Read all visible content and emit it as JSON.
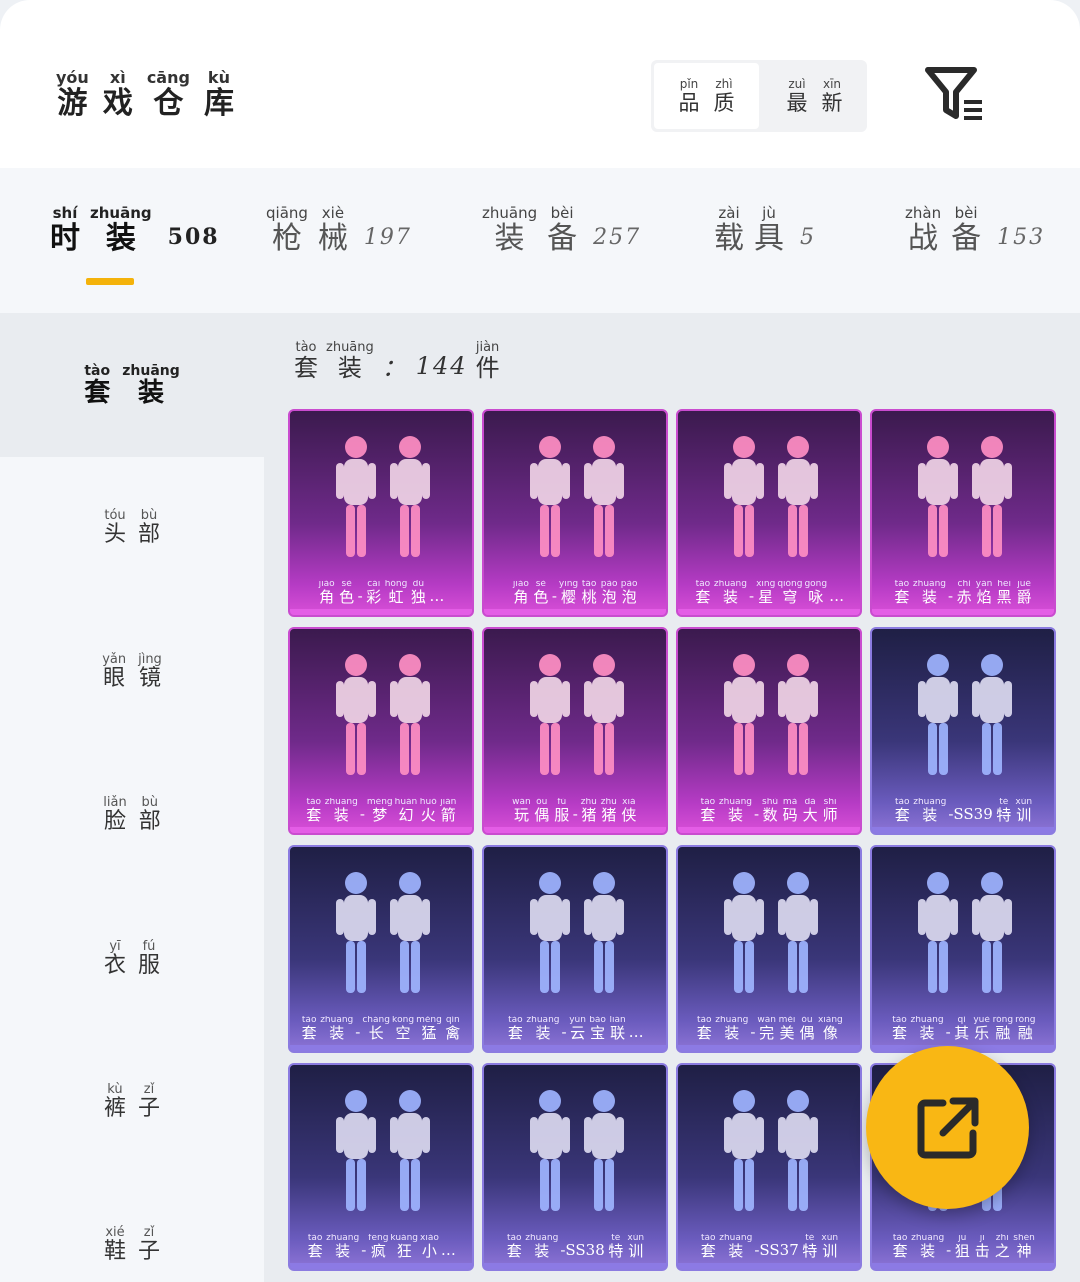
{
  "header": {
    "title": [
      {
        "py": "yóu",
        "hz": "游"
      },
      {
        "py": "xì",
        "hz": "戏"
      },
      {
        "py": "cāng",
        "hz": "仓"
      },
      {
        "py": "kù",
        "hz": "库"
      }
    ],
    "sort": [
      {
        "chars": [
          {
            "py": "pǐn",
            "hz": "品"
          },
          {
            "py": "zhì",
            "hz": "质"
          }
        ],
        "active": true
      },
      {
        "chars": [
          {
            "py": "zuì",
            "hz": "最"
          },
          {
            "py": "xīn",
            "hz": "新"
          }
        ],
        "active": false
      }
    ],
    "filter_icon": "filter-list-icon"
  },
  "tabs": [
    {
      "chars": [
        {
          "py": "shí",
          "hz": "时"
        },
        {
          "py": "zhuāng",
          "hz": "装"
        }
      ],
      "count": "508",
      "active": true
    },
    {
      "chars": [
        {
          "py": "qiāng",
          "hz": "枪"
        },
        {
          "py": "xiè",
          "hz": "械"
        }
      ],
      "count": "197",
      "active": false
    },
    {
      "chars": [
        {
          "py": "zhuāng",
          "hz": "装"
        },
        {
          "py": "bèi",
          "hz": "备"
        }
      ],
      "count": "257",
      "active": false
    },
    {
      "chars": [
        {
          "py": "zài",
          "hz": "载"
        },
        {
          "py": "jù",
          "hz": "具"
        }
      ],
      "count": "5",
      "active": false
    },
    {
      "chars": [
        {
          "py": "zhàn",
          "hz": "战"
        },
        {
          "py": "bèi",
          "hz": "备"
        }
      ],
      "count": "153",
      "active": false
    }
  ],
  "sidebar": [
    {
      "chars": [
        {
          "py": "tào",
          "hz": "套"
        },
        {
          "py": "zhuāng",
          "hz": "装"
        }
      ],
      "active": true
    },
    {
      "chars": [
        {
          "py": "tóu",
          "hz": "头"
        },
        {
          "py": "bù",
          "hz": "部"
        }
      ],
      "active": false
    },
    {
      "chars": [
        {
          "py": "yǎn",
          "hz": "眼"
        },
        {
          "py": "jìng",
          "hz": "镜"
        }
      ],
      "active": false
    },
    {
      "chars": [
        {
          "py": "liǎn",
          "hz": "脸"
        },
        {
          "py": "bù",
          "hz": "部"
        }
      ],
      "active": false
    },
    {
      "chars": [
        {
          "py": "yī",
          "hz": "衣"
        },
        {
          "py": "fú",
          "hz": "服"
        }
      ],
      "active": false
    },
    {
      "chars": [
        {
          "py": "kù",
          "hz": "裤"
        },
        {
          "py": "zǐ",
          "hz": "子"
        }
      ],
      "active": false
    },
    {
      "chars": [
        {
          "py": "xié",
          "hz": "鞋"
        },
        {
          "py": "zǐ",
          "hz": "子"
        }
      ],
      "active": false
    }
  ],
  "section": {
    "chars": [
      {
        "py": "tào",
        "hz": "套"
      },
      {
        "py": "zhuāng",
        "hz": "装"
      }
    ],
    "sep": "：",
    "count": "144",
    "unit": {
      "py": "jiàn",
      "hz": "件"
    }
  },
  "items": [
    {
      "theme": "pink",
      "figure": "pink",
      "tokens": [
        {
          "py": "jiǎo",
          "hz": "角"
        },
        {
          "py": "sè",
          "hz": "色"
        },
        {
          "t": "-"
        },
        {
          "py": "cǎi",
          "hz": "彩"
        },
        {
          "py": "hóng",
          "hz": "虹"
        },
        {
          "py": "dú",
          "hz": "独"
        },
        {
          "t": "…"
        }
      ]
    },
    {
      "theme": "pink",
      "figure": "pink",
      "tokens": [
        {
          "py": "jiǎo",
          "hz": "角"
        },
        {
          "py": "sè",
          "hz": "色"
        },
        {
          "t": "-"
        },
        {
          "py": "yīng",
          "hz": "樱"
        },
        {
          "py": "táo",
          "hz": "桃"
        },
        {
          "py": "pào",
          "hz": "泡"
        },
        {
          "py": "pào",
          "hz": "泡"
        }
      ]
    },
    {
      "theme": "pink",
      "figure": "pink",
      "tokens": [
        {
          "py": "tào",
          "hz": "套"
        },
        {
          "py": "zhuāng",
          "hz": "装"
        },
        {
          "t": "-"
        },
        {
          "py": "xīng",
          "hz": "星"
        },
        {
          "py": "qióng",
          "hz": "穹"
        },
        {
          "py": "gōng",
          "hz": "咏"
        },
        {
          "t": "…"
        }
      ]
    },
    {
      "theme": "pink",
      "figure": "pink",
      "tokens": [
        {
          "py": "tào",
          "hz": "套"
        },
        {
          "py": "zhuāng",
          "hz": "装"
        },
        {
          "t": "-"
        },
        {
          "py": "chì",
          "hz": "赤"
        },
        {
          "py": "yàn",
          "hz": "焰"
        },
        {
          "py": "hēi",
          "hz": "黑"
        },
        {
          "py": "jué",
          "hz": "爵"
        }
      ]
    },
    {
      "theme": "pink",
      "figure": "pink",
      "tokens": [
        {
          "py": "tào",
          "hz": "套"
        },
        {
          "py": "zhuāng",
          "hz": "装"
        },
        {
          "t": "-"
        },
        {
          "py": "mèng",
          "hz": "梦"
        },
        {
          "py": "huàn",
          "hz": "幻"
        },
        {
          "py": "huǒ",
          "hz": "火"
        },
        {
          "py": "jiàn",
          "hz": "箭"
        }
      ]
    },
    {
      "theme": "pink",
      "figure": "pink",
      "tokens": [
        {
          "py": "wán",
          "hz": "玩"
        },
        {
          "py": "ǒu",
          "hz": "偶"
        },
        {
          "py": "fú",
          "hz": "服"
        },
        {
          "t": "-"
        },
        {
          "py": "zhū",
          "hz": "猪"
        },
        {
          "py": "zhū",
          "hz": "猪"
        },
        {
          "py": "xiá",
          "hz": "侠"
        }
      ]
    },
    {
      "theme": "pink",
      "figure": "pink",
      "tokens": [
        {
          "py": "tào",
          "hz": "套"
        },
        {
          "py": "zhuāng",
          "hz": "装"
        },
        {
          "t": "-"
        },
        {
          "py": "shù",
          "hz": "数"
        },
        {
          "py": "mǎ",
          "hz": "码"
        },
        {
          "py": "dà",
          "hz": "大"
        },
        {
          "py": "shī",
          "hz": "师"
        }
      ]
    },
    {
      "theme": "blue",
      "figure": "blue",
      "tokens": [
        {
          "py": "tào",
          "hz": "套"
        },
        {
          "py": "zhuāng",
          "hz": "装"
        },
        {
          "t": "-SS39"
        },
        {
          "py": "tè",
          "hz": "特"
        },
        {
          "py": "xùn",
          "hz": "训"
        }
      ]
    },
    {
      "theme": "blue",
      "figure": "blue",
      "tokens": [
        {
          "py": "tào",
          "hz": "套"
        },
        {
          "py": "zhuāng",
          "hz": "装"
        },
        {
          "t": "-"
        },
        {
          "py": "cháng",
          "hz": "长"
        },
        {
          "py": "kōng",
          "hz": "空"
        },
        {
          "py": "měng",
          "hz": "猛"
        },
        {
          "py": "qín",
          "hz": "禽"
        }
      ]
    },
    {
      "theme": "blue",
      "figure": "blue",
      "tokens": [
        {
          "py": "tào",
          "hz": "套"
        },
        {
          "py": "zhuāng",
          "hz": "装"
        },
        {
          "t": "-"
        },
        {
          "py": "yún",
          "hz": "云"
        },
        {
          "py": "bǎo",
          "hz": "宝"
        },
        {
          "py": "lián",
          "hz": "联"
        },
        {
          "t": "…"
        }
      ]
    },
    {
      "theme": "blue",
      "figure": "blue",
      "tokens": [
        {
          "py": "tào",
          "hz": "套"
        },
        {
          "py": "zhuāng",
          "hz": "装"
        },
        {
          "t": "-"
        },
        {
          "py": "wán",
          "hz": "完"
        },
        {
          "py": "měi",
          "hz": "美"
        },
        {
          "py": "ǒu",
          "hz": "偶"
        },
        {
          "py": "xiàng",
          "hz": "像"
        }
      ]
    },
    {
      "theme": "blue",
      "figure": "blue",
      "tokens": [
        {
          "py": "tào",
          "hz": "套"
        },
        {
          "py": "zhuāng",
          "hz": "装"
        },
        {
          "t": "-"
        },
        {
          "py": "qí",
          "hz": "其"
        },
        {
          "py": "yuè",
          "hz": "乐"
        },
        {
          "py": "róng",
          "hz": "融"
        },
        {
          "py": "róng",
          "hz": "融"
        }
      ]
    },
    {
      "theme": "blue",
      "figure": "blue",
      "tokens": [
        {
          "py": "tào",
          "hz": "套"
        },
        {
          "py": "zhuāng",
          "hz": "装"
        },
        {
          "t": "-"
        },
        {
          "py": "fēng",
          "hz": "疯"
        },
        {
          "py": "kuáng",
          "hz": "狂"
        },
        {
          "py": "xiǎo",
          "hz": "小"
        },
        {
          "t": "…"
        }
      ]
    },
    {
      "theme": "blue",
      "figure": "blue",
      "tokens": [
        {
          "py": "tào",
          "hz": "套"
        },
        {
          "py": "zhuāng",
          "hz": "装"
        },
        {
          "t": "-SS38"
        },
        {
          "py": "tè",
          "hz": "特"
        },
        {
          "py": "xùn",
          "hz": "训"
        }
      ]
    },
    {
      "theme": "blue",
      "figure": "blue",
      "tokens": [
        {
          "py": "tào",
          "hz": "套"
        },
        {
          "py": "zhuāng",
          "hz": "装"
        },
        {
          "t": "-SS37"
        },
        {
          "py": "tè",
          "hz": "特"
        },
        {
          "py": "xùn",
          "hz": "训"
        }
      ]
    },
    {
      "theme": "blue",
      "figure": "blue",
      "tokens": [
        {
          "py": "tào",
          "hz": "套"
        },
        {
          "py": "zhuāng",
          "hz": "装"
        },
        {
          "t": "-"
        },
        {
          "py": "jū",
          "hz": "狙"
        },
        {
          "py": "jī",
          "hz": "击"
        },
        {
          "py": "zhī",
          "hz": "之"
        },
        {
          "py": "shén",
          "hz": "神"
        }
      ]
    }
  ],
  "fab_icon": "share-export-icon",
  "colors": {
    "accent": "#f4b20a",
    "fab": "#f9b714",
    "pink_card": "#c94ccf",
    "blue_card": "#8b7be0"
  }
}
